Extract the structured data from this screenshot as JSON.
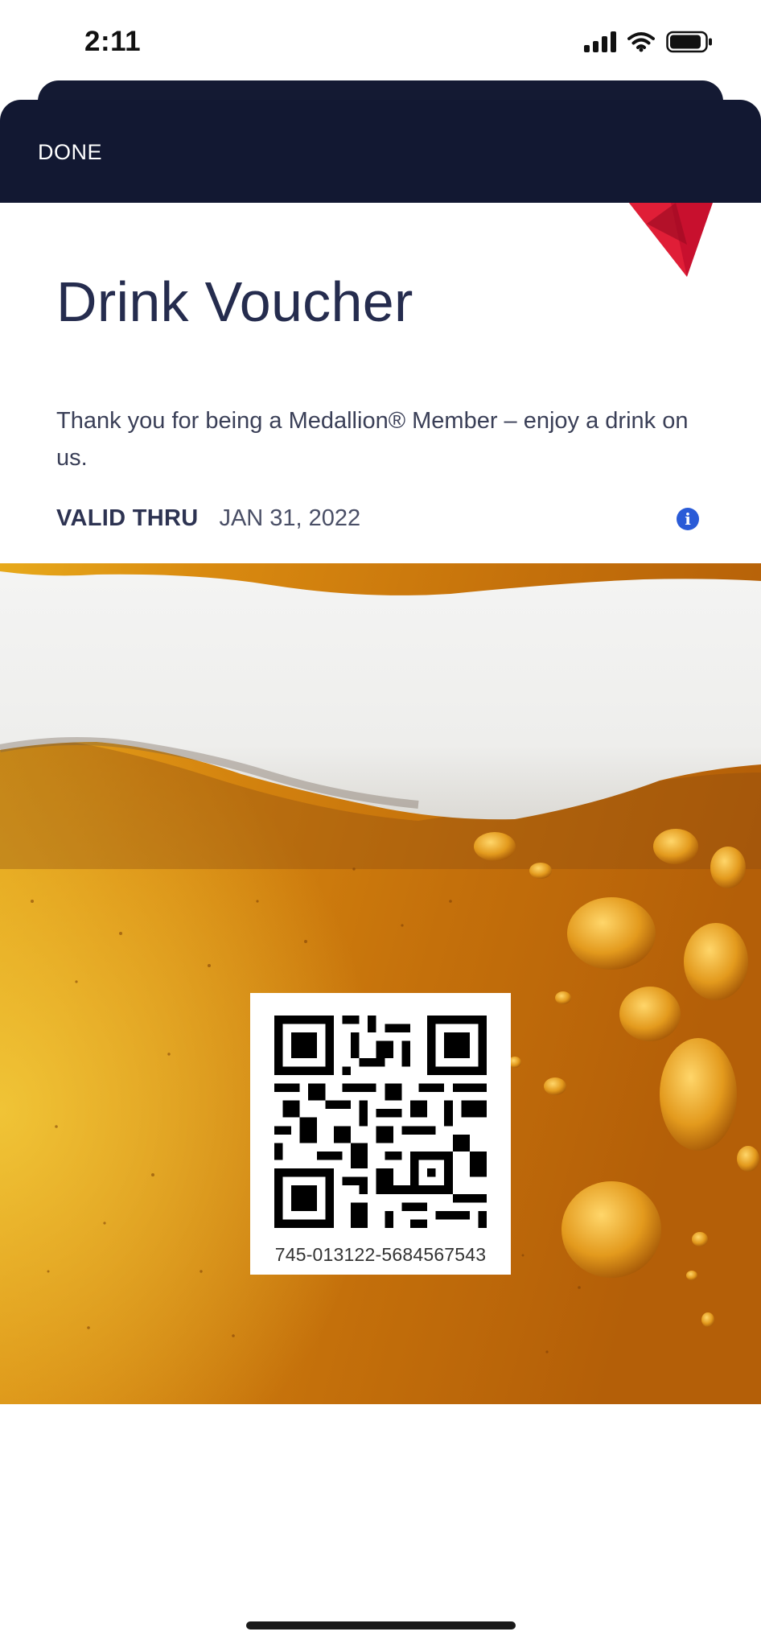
{
  "status_bar": {
    "time": "2:11"
  },
  "header": {
    "done_label": "DONE"
  },
  "voucher": {
    "title": "Drink Voucher",
    "description": "Thank you for being a Medallion® Member – enjoy a drink on us.",
    "valid_label": "VALID THRU",
    "valid_date": "JAN 31, 2022",
    "code": "745-013122-5684567543"
  },
  "colors": {
    "header_bg": "#121832",
    "brand_red": "#c8102e",
    "info_blue": "#2a5bd7"
  },
  "icons": {
    "logo": "delta-widget-logo",
    "info": "info-icon"
  }
}
